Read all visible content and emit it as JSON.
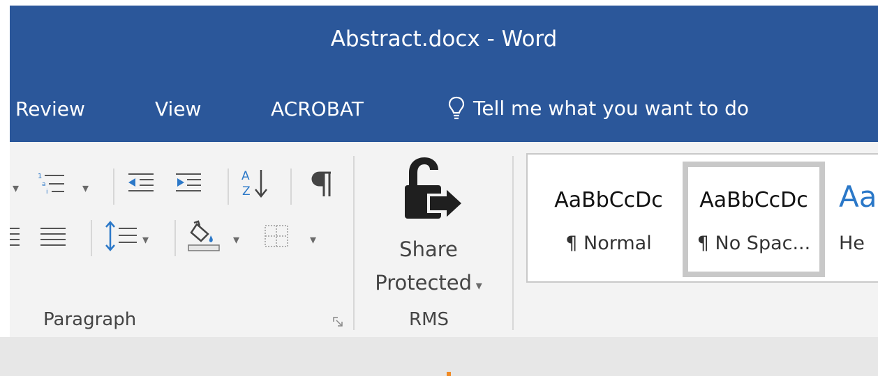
{
  "window": {
    "title": "Abstract.docx - Word"
  },
  "tabs": [
    {
      "label": "Review"
    },
    {
      "label": "View"
    },
    {
      "label": "ACROBAT"
    }
  ],
  "tell_me": {
    "text": "Tell me what you want to do",
    "icon": "lightbulb-icon"
  },
  "ribbon": {
    "paragraph_group": {
      "label": "Paragraph",
      "icons": [
        "multilevel-list-icon",
        "decrease-indent-icon",
        "increase-indent-icon",
        "sort-icon",
        "pilcrow-icon",
        "align-right-icon",
        "justify-icon",
        "line-spacing-icon",
        "shading-icon",
        "borders-icon"
      ]
    },
    "rms_group": {
      "label": "RMS",
      "button_line1": "Share",
      "button_line2": "Protected",
      "icon": "lock-arrow-icon"
    },
    "styles": [
      {
        "sample": "AaBbCcDc",
        "name": "¶ Normal"
      },
      {
        "sample": "AaBbCcDc",
        "name": "¶ No Spac..."
      },
      {
        "sample": "Aa",
        "name": "He"
      }
    ]
  },
  "colors": {
    "title_bar": "#2b579a",
    "ribbon_bg": "#f3f3f3",
    "heading_accent": "#2b78c8"
  }
}
